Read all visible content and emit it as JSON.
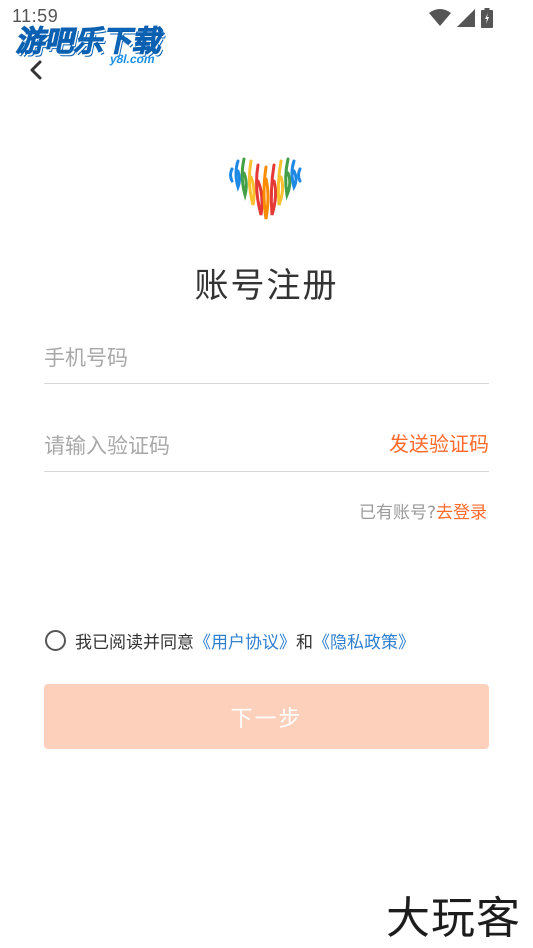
{
  "status_bar": {
    "time": "11:59"
  },
  "watermark": {
    "main": "游吧乐下载",
    "sub": "y8l.com"
  },
  "page": {
    "title": "账号注册",
    "phone_placeholder": "手机号码",
    "code_placeholder": "请输入验证码",
    "send_code_label": "发送验证码",
    "has_account_text": "已有账号?",
    "login_link": "去登录",
    "agree_prefix": "我已阅读并同意",
    "user_agreement": "《用户协议》",
    "and_text": "和",
    "privacy_policy": "《隐私政策》",
    "next_label": "下一步"
  },
  "brand": {
    "mark": "大玩客"
  },
  "colors": {
    "accent": "#ff6a2b",
    "link": "#2f80d0",
    "button_disabled": "#fdd0bc"
  },
  "icons": [
    "back-icon",
    "wifi-icon",
    "signal-icon",
    "battery-icon",
    "app-logo-heart"
  ]
}
